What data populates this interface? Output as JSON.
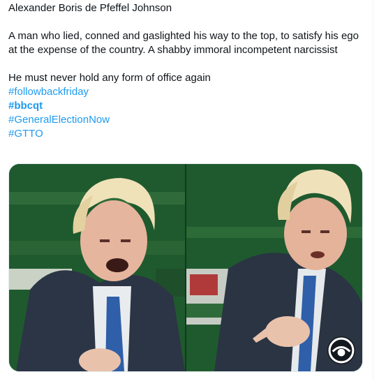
{
  "tweet": {
    "text_lines": [
      "Alexander Boris de Pfeffel Johnson",
      "A man who lied, conned and gaslighted his way to the top, to satisfy his ego at the expense of the country. A shabby immoral incompetent narcissist",
      "He must never hold any form of office again"
    ],
    "hashtags": [
      {
        "label": "#followbackfriday",
        "bold": false
      },
      {
        "label": "#bbcqt",
        "bold": true
      },
      {
        "label": "#GeneralElectionNow",
        "bold": false
      },
      {
        "label": "#GTTO",
        "bold": false
      }
    ]
  },
  "media": {
    "photos": [
      {
        "icon": "politician-shouting-photo"
      },
      {
        "icon": "politician-pointing-photo"
      }
    ],
    "overlay_icon": "eye-badge-icon"
  },
  "colors": {
    "link": "#1d9bf0",
    "text": "#0f1419",
    "bench_green": "#2f6b3a"
  }
}
